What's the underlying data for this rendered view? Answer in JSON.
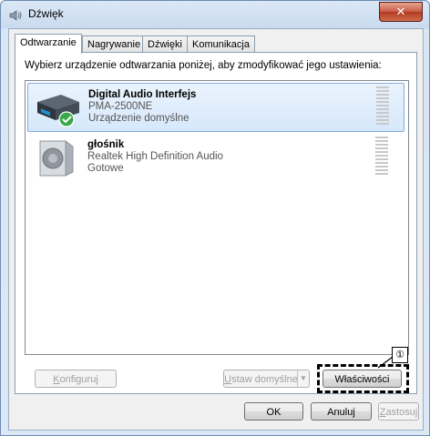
{
  "window": {
    "title": "Dźwięk",
    "close_label": "✕"
  },
  "tabs": [
    {
      "label": "Odtwarzanie"
    },
    {
      "label": "Nagrywanie"
    },
    {
      "label": "Dźwięki"
    },
    {
      "label": "Komunikacja"
    }
  ],
  "instruction": "Wybierz urządzenie odtwarzania poniżej, aby zmodyfikować jego ustawienia:",
  "devices": [
    {
      "name": "Digital Audio Interfejs",
      "line2": "PMA-2500NE",
      "status": "Urządzenie domyślne",
      "icon": "amplifier-icon",
      "default_badge": "check-icon"
    },
    {
      "name": "głośnik",
      "line2": "Realtek High Definition Audio",
      "status": "Gotowe",
      "icon": "speaker-icon"
    }
  ],
  "buttons": {
    "configure": {
      "pre": "",
      "accel": "K",
      "post": "onfiguruj"
    },
    "set_default": {
      "pre": "",
      "accel": "U",
      "post": "staw domyślne"
    },
    "properties": "Właściwości",
    "ok": "OK",
    "cancel": "Anuluj",
    "apply": {
      "pre": "",
      "accel": "Z",
      "post": "astosuj"
    }
  },
  "callout": "①",
  "colors": {
    "selection": "#d6e8fb",
    "check": "#3aa84a",
    "close": "#c75a45"
  }
}
